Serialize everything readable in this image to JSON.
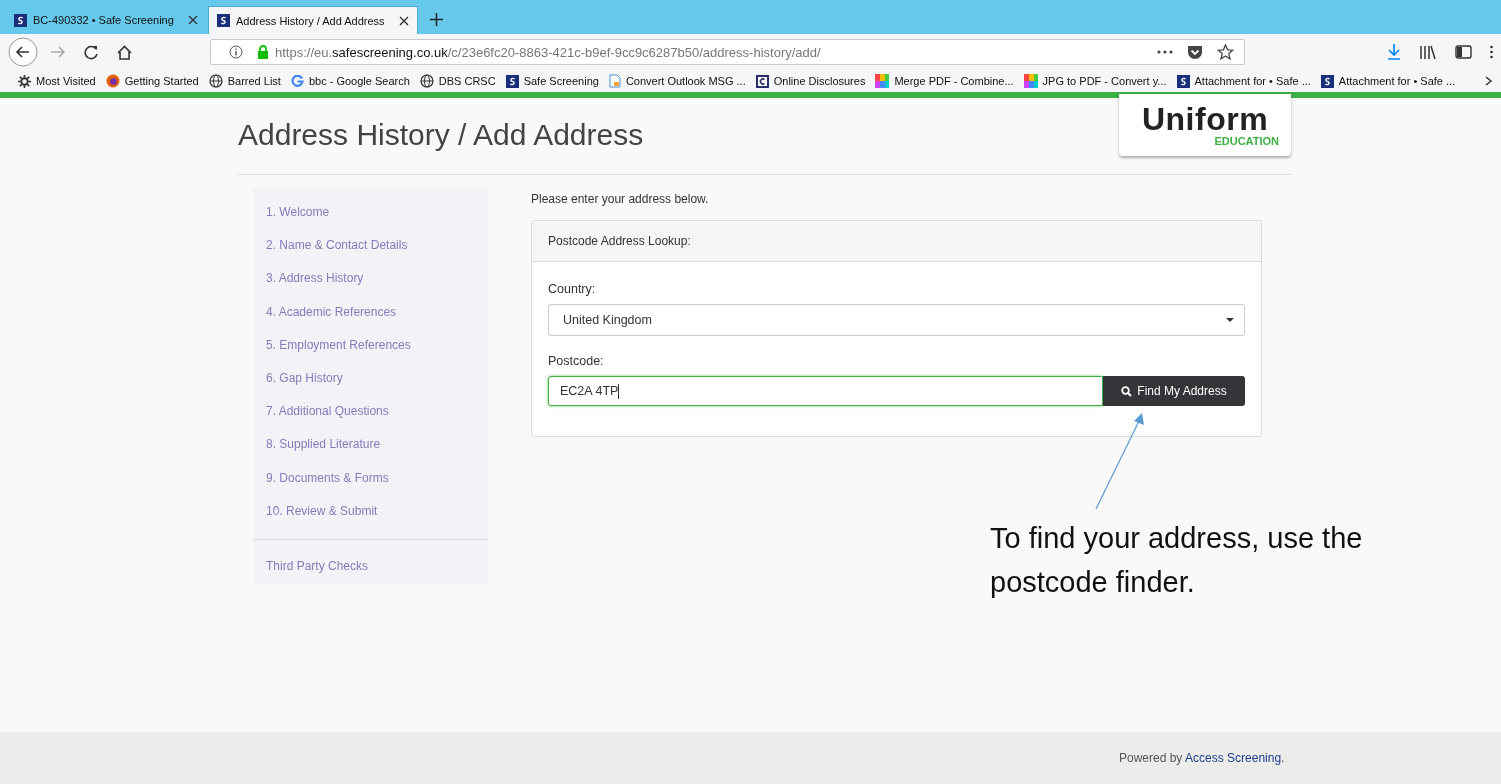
{
  "tabs": [
    {
      "label": "BC-490332 • Safe Screening",
      "selected": false
    },
    {
      "label": "Address History / Add Address",
      "selected": true
    }
  ],
  "url": {
    "prefix": "https://eu.",
    "domain": "safescreening.co.uk",
    "path": "/c/23e6fc20-8863-421c-b9ef-9cc9c6287b50/address-history/add/"
  },
  "bookmarks": [
    {
      "kind": "gear",
      "label": "Most Visited"
    },
    {
      "kind": "firefox",
      "label": "Getting Started"
    },
    {
      "kind": "globe",
      "label": "Barred List"
    },
    {
      "kind": "google",
      "label": "bbc - Google Search"
    },
    {
      "kind": "globe",
      "label": "DBS CRSC"
    },
    {
      "kind": "s",
      "label": "Safe Screening"
    },
    {
      "kind": "doc",
      "label": "Convert Outlook MSG ..."
    },
    {
      "kind": "c",
      "label": "Online Disclosures"
    },
    {
      "kind": "grid",
      "label": "Merge PDF - Combine..."
    },
    {
      "kind": "grid",
      "label": "JPG to PDF - Convert y..."
    },
    {
      "kind": "s",
      "label": "Attachment for • Safe ..."
    },
    {
      "kind": "s",
      "label": "Attachment for • Safe ..."
    }
  ],
  "page": {
    "title": "Address History / Add Address",
    "logo": {
      "name": "Uniform",
      "subtitle": "EDUCATION"
    }
  },
  "sidebar": {
    "items": [
      "1. Welcome",
      "2. Name & Contact Details",
      "3. Address History",
      "4. Academic References",
      "5. Employment References",
      "6. Gap History",
      "7. Additional Questions",
      "8. Supplied Literature",
      "9. Documents & Forms",
      "10. Review & Submit"
    ],
    "extra": "Third Party Checks"
  },
  "form": {
    "intro": "Please enter your address below.",
    "panel_title": "Postcode Address Lookup:",
    "country_label": "Country:",
    "country_value": "United Kingdom",
    "postcode_label": "Postcode:",
    "postcode_value": "EC2A 4TP",
    "button": "Find My Address"
  },
  "annotation": "To find your address, use the postcode finder.",
  "footer": {
    "text": "Powered by",
    "link": "Access Screening",
    "end": "."
  }
}
